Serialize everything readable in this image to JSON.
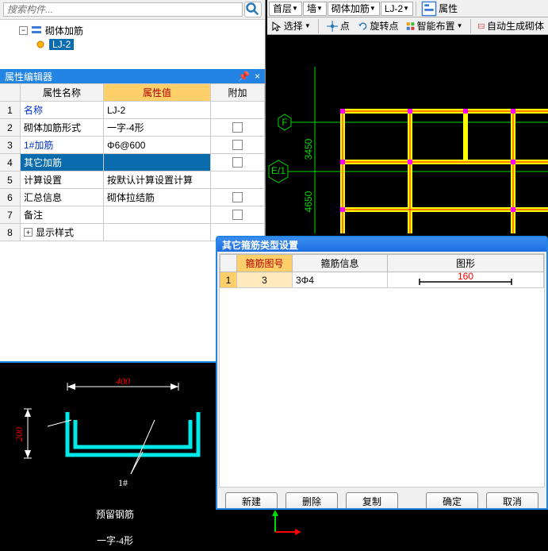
{
  "search": {
    "placeholder": "搜索构件..."
  },
  "tree": {
    "root": "砌体加筋",
    "child": "LJ-2"
  },
  "prop_editor": {
    "title": "属性编辑器",
    "columns": {
      "row": "",
      "name": "属性名称",
      "value": "属性值",
      "add": "附加"
    },
    "rows": [
      {
        "n": "1",
        "name": "名称",
        "value": "LJ-2",
        "link": true,
        "chk": false
      },
      {
        "n": "2",
        "name": "砌体加筋形式",
        "value": "一字-4形",
        "link": false,
        "chk": true
      },
      {
        "n": "3",
        "name": "1#加筋",
        "value": "Φ6@600",
        "link": true,
        "chk": true
      },
      {
        "n": "4",
        "name": "其它加筋",
        "value": "",
        "link": false,
        "chk": true,
        "sel": true
      },
      {
        "n": "5",
        "name": "计算设置",
        "value": "按默认计算设置计算",
        "link": false,
        "chk": false
      },
      {
        "n": "6",
        "name": "汇总信息",
        "value": "砌体拉结筋",
        "link": false,
        "chk": true
      },
      {
        "n": "7",
        "name": "备注",
        "value": "",
        "link": false,
        "chk": true
      },
      {
        "n": "8",
        "name": "显示样式",
        "value": "",
        "link": false,
        "chk": false,
        "exp": true
      }
    ]
  },
  "preview": {
    "dim_w": "400",
    "dim_h": "200",
    "label": "1#",
    "title1": "预留钢筋",
    "title2": "一字-4形"
  },
  "top_toolbar": {
    "layer": "首层",
    "category": "墙",
    "type": "砌体加筋",
    "item": "LJ-2",
    "prop_btn": "属性"
  },
  "toolbar2": {
    "select": "选择",
    "point": "点",
    "rotpoint": "旋转点",
    "smart": "智能布置",
    "auto": "自动生成砌体"
  },
  "canvas": {
    "axis1": "F",
    "axis2": "E/1",
    "dim1": "3450",
    "dim2": "4650"
  },
  "dialog": {
    "title": "其它箍筋类型设置",
    "columns": {
      "id": "箍筋图号",
      "info": "箍筋信息",
      "shape": "图形"
    },
    "row": {
      "n": "1",
      "id": "3",
      "info": "3Φ4",
      "shape_dim": "160"
    },
    "buttons": {
      "new": "新建",
      "del": "删除",
      "copy": "复制",
      "ok": "确定",
      "cancel": "取消"
    }
  }
}
